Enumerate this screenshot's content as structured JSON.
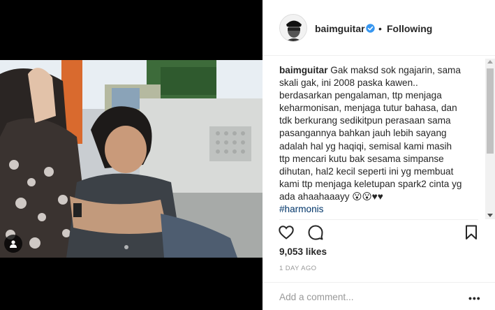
{
  "header": {
    "username": "baimguitar",
    "separator": "•",
    "follow_status": "Following"
  },
  "caption": {
    "username": "baimguitar",
    "lines": [
      " Gak maksd sok ngajarin, sama",
      "skali gak, ini 2008 paska kawen..",
      "berdasarkan pengalaman, ttp menjaga",
      "keharmonisan, menjaga tutur bahasa, dan",
      "tdk berkurang sedikitpun perasaan sama",
      "pasangannya bahkan jauh lebih sayang",
      "adalah hal yg haqiqi, semisal kami masih",
      "ttp mencari kutu bak sesama simpanse",
      "dihutan, hal2 kecil seperti ini yg membuat",
      "kami ttp menjaga keletupan spark2 cinta yg",
      "ada ahaahaaayy 😮😮♥♥"
    ],
    "hashtag": "#harmonis"
  },
  "stats": {
    "likes": "9,053 likes",
    "time": "1 DAY AGO"
  },
  "comment": {
    "placeholder": "Add a comment...",
    "more": "•••"
  },
  "icons": {
    "verified": "verified-badge-icon",
    "like": "heart-icon",
    "comment": "comment-bubble-icon",
    "save": "bookmark-icon",
    "user_tag": "person-icon",
    "more": "more-options-icon"
  },
  "colors": {
    "verified": "#3897f0",
    "text": "#262626",
    "muted": "#999999",
    "hashtag": "#003569"
  }
}
